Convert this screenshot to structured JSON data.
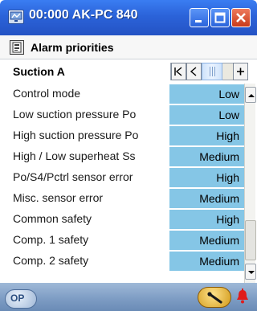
{
  "window": {
    "title": "00:000 AK-PC 840",
    "icon": "display-icon",
    "buttons": [
      "minimize-button",
      "maximize-button",
      "close-button"
    ]
  },
  "header": {
    "icon": "list-icon",
    "title": "Alarm priorities"
  },
  "section": {
    "title": "Suction A",
    "nav": {
      "first": "|<",
      "prev": "<",
      "next": "+"
    }
  },
  "rows": [
    {
      "label": "Control mode",
      "value": "Low"
    },
    {
      "label": "Low suction pressure Po",
      "value": "Low"
    },
    {
      "label": "High suction pressure Po",
      "value": "High"
    },
    {
      "label": "High / Low superheat Ss",
      "value": "Medium"
    },
    {
      "label": "Po/S4/Pctrl sensor error",
      "value": "High"
    },
    {
      "label": "Misc. sensor error",
      "value": "Medium"
    },
    {
      "label": "Common safety",
      "value": "High"
    },
    {
      "label": "Comp. 1 safety",
      "value": "Medium"
    },
    {
      "label": "Comp. 2 safety",
      "value": "Medium"
    }
  ],
  "bottombar": {
    "left_icon": "operator-icon",
    "left_text": "OP",
    "right_icons": [
      "tool-icon",
      "alarm-bell-icon"
    ]
  },
  "colors": {
    "titlebar": "#2b63d9",
    "value_cell": "#85c6e6",
    "bottombar": "#7e9dc4",
    "bell": "#e01b1b"
  }
}
